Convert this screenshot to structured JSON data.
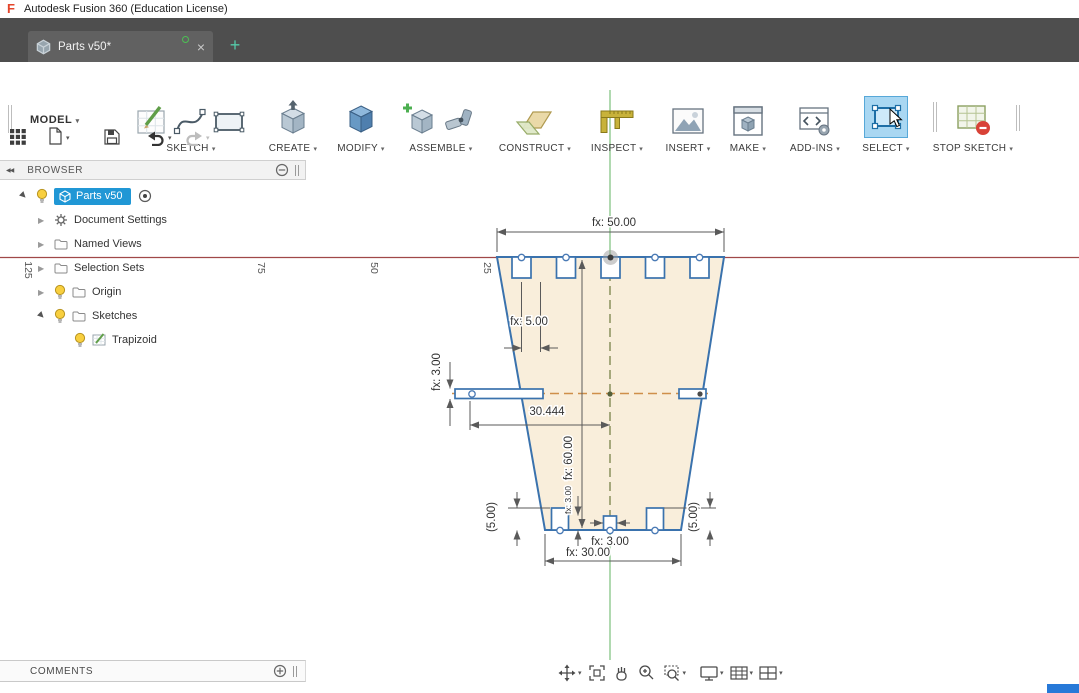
{
  "title_bar": {
    "app_title": "Autodesk Fusion 360 (Education License)"
  },
  "tab_bar": {
    "active_tab": "Parts v50*"
  },
  "qat": {},
  "ribbon": {
    "workspace": "MODEL",
    "groups": [
      {
        "label": "SKETCH"
      },
      {
        "label": "CREATE"
      },
      {
        "label": "MODIFY"
      },
      {
        "label": "ASSEMBLE"
      },
      {
        "label": "CONSTRUCT"
      },
      {
        "label": "INSPECT"
      },
      {
        "label": "INSERT"
      },
      {
        "label": "MAKE"
      },
      {
        "label": "ADD-INS"
      },
      {
        "label": "SELECT"
      },
      {
        "label": "STOP SKETCH"
      }
    ]
  },
  "browser": {
    "header": "BROWSER",
    "root_label": "Parts v50",
    "items": [
      "Document Settings",
      "Named Views",
      "Selection Sets",
      "Origin",
      "Sketches"
    ],
    "sketch_child": "Trapizoid"
  },
  "comments_bar": {
    "label": "COMMENTS"
  },
  "canvas": {
    "dims": {
      "d_top_width": "fx: 50.00",
      "d_notch_width": "fx: 5.00",
      "d_slot_height": "fx: 3.00",
      "d_slot_span": "30.444",
      "d_total_height": "fx: 60.00",
      "d_center_notch_height": "fx: 3.00",
      "d_bottom_notch_left": "(5.00)",
      "d_bottom_notch_right": "(5.00)",
      "d_center_notch_width": "fx: 3.00",
      "d_bottom_width": "fx: 30.00"
    },
    "ruler_labels": [
      "125",
      "75",
      "50",
      "25"
    ]
  },
  "icons": {
    "caret": "▾",
    "triangle": "▶",
    "close": "×",
    "plus": "+",
    "collapse": "◀◀"
  },
  "colors": {
    "selection_blue": "#2097d5",
    "sketch_line": "#3a72ad",
    "sketch_fill": "#f9eedb",
    "axis_red": "#a04848",
    "axis_green": "#8fc98f",
    "select_highlight": "#a9d7f2",
    "taskbar_blue": "#2779d8"
  }
}
